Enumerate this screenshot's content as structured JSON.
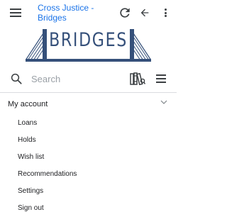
{
  "header": {
    "title": "Cross Justice - Bridges",
    "icons": {
      "menu": "hamburger-menu-icon",
      "reload": "reload-icon",
      "back": "back-arrow-icon",
      "more": "more-vert-icon"
    }
  },
  "logo": {
    "text": "BRIDGES",
    "color": "#35507a"
  },
  "search": {
    "placeholder": "Search",
    "value": "",
    "icons": {
      "search": "search-icon",
      "library": "books-icon",
      "list": "list-menu-icon"
    }
  },
  "account": {
    "label": "My account",
    "expanded": true,
    "items": [
      {
        "label": "Loans"
      },
      {
        "label": "Holds"
      },
      {
        "label": "Wish list"
      },
      {
        "label": "Recommendations"
      },
      {
        "label": "Settings"
      },
      {
        "label": "Sign out"
      }
    ]
  },
  "colors": {
    "accent": "#1a73e8",
    "logo": "#35507a",
    "divider": "#dadce0"
  }
}
